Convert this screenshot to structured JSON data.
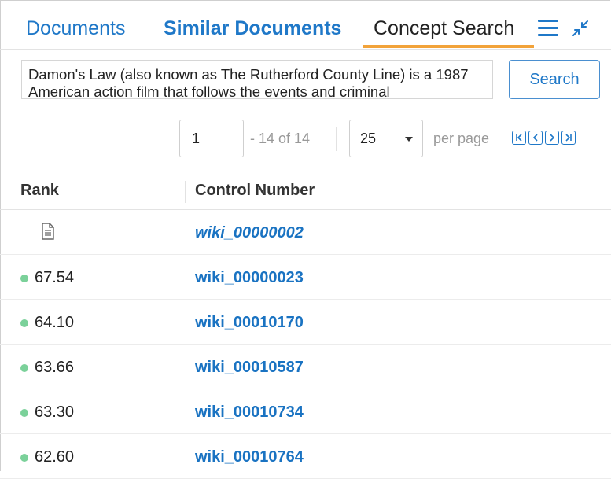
{
  "tabs": [
    {
      "label": "Documents"
    },
    {
      "label": "Similar Documents"
    },
    {
      "label": "Concept Search"
    }
  ],
  "icons": {
    "menu": "hamburger-menu-icon",
    "collapse": "collapse-arrows-icon",
    "document": "document-icon"
  },
  "colors": {
    "link": "#1f78c8",
    "active_tab_underline": "#f2a33a",
    "rank_dot": "#7bd19a"
  },
  "search": {
    "query": "Damon's Law (also known as The Rutherford County Line) is a 1987 American action film that follows the events and criminal",
    "button": "Search"
  },
  "pagination": {
    "page": "1",
    "range": "- 14 of 14",
    "per_page": "25",
    "per_page_label": "per page"
  },
  "table": {
    "headers": [
      "Rank",
      "Control Number"
    ],
    "rows": [
      {
        "rank": "",
        "control": "wiki_00000002",
        "is_source": true
      },
      {
        "rank": "67.54",
        "control": "wiki_00000023",
        "is_source": false
      },
      {
        "rank": "64.10",
        "control": "wiki_00010170",
        "is_source": false
      },
      {
        "rank": "63.66",
        "control": "wiki_00010587",
        "is_source": false
      },
      {
        "rank": "63.30",
        "control": "wiki_00010734",
        "is_source": false
      },
      {
        "rank": "62.60",
        "control": "wiki_00010764",
        "is_source": false
      }
    ]
  }
}
